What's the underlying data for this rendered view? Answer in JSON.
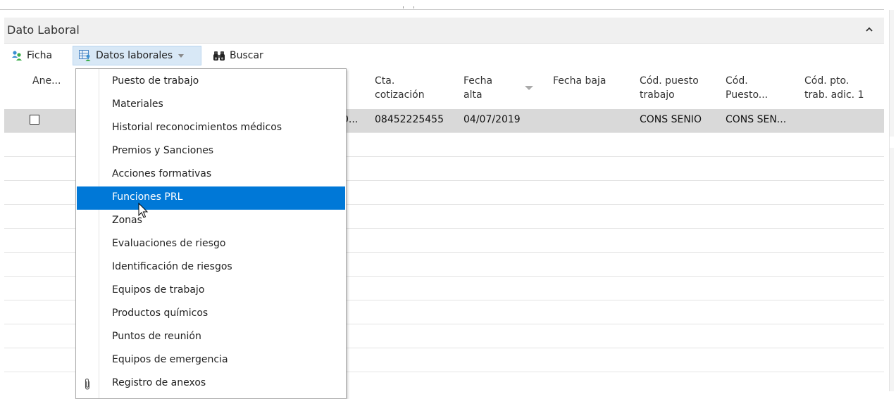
{
  "panel": {
    "title": "Dato Laboral"
  },
  "toolbar": {
    "ficha_label": "Ficha",
    "datos_label": "Datos laborales",
    "buscar_label": "Buscar"
  },
  "columns": [
    {
      "l1": "Ane...",
      "l2": ""
    },
    {
      "l1": "Cta.",
      "l2": "cotización"
    },
    {
      "l1": "Fecha",
      "l2": "alta"
    },
    {
      "l1": "Fecha baja",
      "l2": ""
    },
    {
      "l1": "Cód. puesto",
      "l2": "trabajo"
    },
    {
      "l1": "Cód.",
      "l2": "Puesto..."
    },
    {
      "l1": "Cód. pto.",
      "l2": "trab. adic. 1"
    }
  ],
  "row": {
    "hidden_fragment": "0...",
    "cta": "08452225455",
    "fecha_alta": "04/07/2019",
    "fecha_baja": "",
    "cod_puesto": "CONS SENIO",
    "cod_puesto2": "CONS SEN..."
  },
  "menu": {
    "items": [
      "Puesto de trabajo",
      "Materiales",
      "Historial reconocimientos médicos",
      "Premios y Sanciones",
      "Acciones formativas",
      "Funciones PRL",
      "Zonas",
      "Evaluaciones de riesgo",
      "Identificación de riesgos",
      "Equipos de trabajo",
      "Productos químicos",
      "Puntos de reunión",
      "Equipos de emergencia",
      "Registro de anexos"
    ],
    "active_index": 5
  },
  "colors": {
    "highlight": "#0078d7",
    "selected_row": "#d9d9d9",
    "toolbar_active": "#d8e8f6"
  }
}
